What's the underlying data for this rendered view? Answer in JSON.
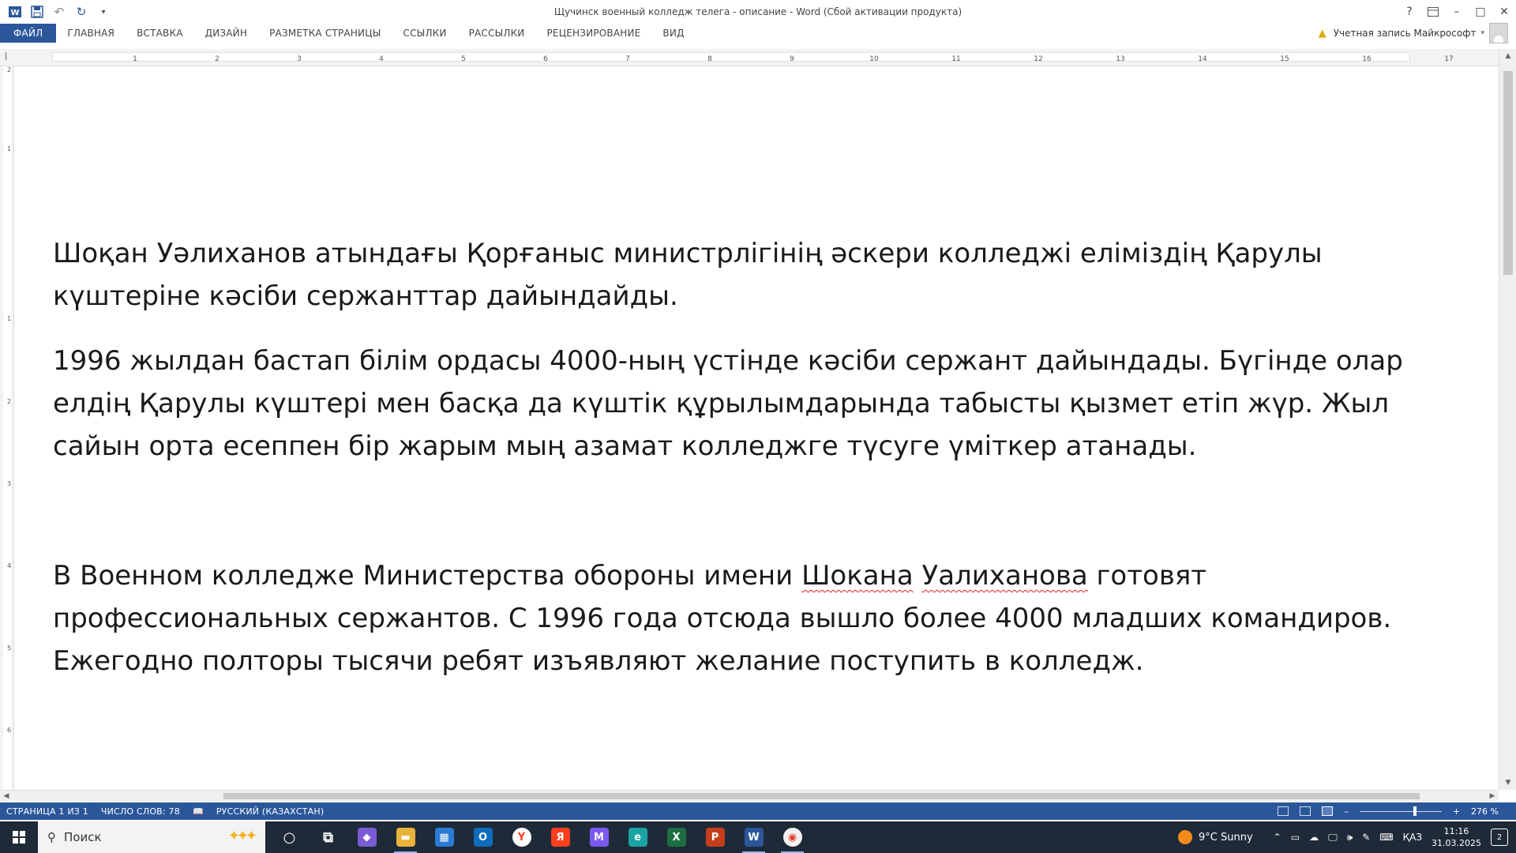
{
  "window": {
    "title": "Щучинск военный колледж  телега - описание - Word (Сбой активации продукта)",
    "help_icon": "?",
    "ribbon_display_icon": "ribbon-display-options-icon",
    "minimize_icon": "–",
    "restore_icon": "□",
    "close_icon": "✕"
  },
  "quick_access": {
    "app_icon": "word-app-icon",
    "save_icon": "save-icon",
    "undo_icon": "undo-icon",
    "redo_icon": "redo-icon",
    "customize_icon": "▾"
  },
  "ribbon": {
    "tabs": [
      {
        "label": "ФАЙЛ"
      },
      {
        "label": "ГЛАВНАЯ"
      },
      {
        "label": "ВСТАВКА"
      },
      {
        "label": "ДИЗАЙН"
      },
      {
        "label": "РАЗМЕТКА СТРАНИЦЫ"
      },
      {
        "label": "ССЫЛКИ"
      },
      {
        "label": "РАССЫЛКИ"
      },
      {
        "label": "РЕЦЕНЗИРОВАНИЕ"
      },
      {
        "label": "ВИД"
      }
    ],
    "account_label": "Учетная запись Майкрософт"
  },
  "ruler": {
    "numbers": [
      "1",
      "2",
      "3",
      "4",
      "5",
      "6",
      "7",
      "8",
      "9",
      "10",
      "11",
      "12",
      "13",
      "14",
      "15",
      "16",
      "17"
    ],
    "vertical_numbers": [
      "2",
      "1",
      "1",
      "2",
      "3",
      "4",
      "5",
      "6"
    ]
  },
  "document": {
    "paragraphs": [
      {
        "text": "Шоқан Уәлиханов атындағы Қорғаныс министрлігінің әскери колледжі еліміздің Қарулы күштеріне кәсіби сержанттар дайындайды."
      },
      {
        "text": "1996 жылдан бастап білім ордасы 4000-ның үстінде кәсіби сержант дайындады. Бүгінде олар елдің Қарулы күштері мен басқа да күштік құрылымдарында табысты қызмет етіп жүр. Жыл сайын орта есеппен бір жарым мың азамат колледжге түсуге үміткер атанады."
      },
      {
        "text_before": "В Военном колледже Министерства обороны имени ",
        "misspelled_1": "Шокана",
        "space": " ",
        "misspelled_2": "Уалиханова",
        "text_after": " готовят профессиональных сержантов. С 1996 года отсюда вышло более 4000 младших командиров. Ежегодно полторы тысячи ребят изъявляют желание поступить в колледж."
      }
    ]
  },
  "status": {
    "page": "СТРАНИЦА 1 ИЗ 1",
    "words": "ЧИСЛО СЛОВ: 78",
    "language": "РУССКИЙ (КАЗАХСТАН)",
    "zoom_minus": "–",
    "zoom_plus": "+",
    "zoom": "276 %"
  },
  "taskbar": {
    "search_placeholder": "Поиск",
    "apps": [
      {
        "name": "cortana-icon",
        "glyph": "○"
      },
      {
        "name": "task-view-icon",
        "glyph": "⧉"
      },
      {
        "name": "copilot-icon",
        "glyph": "◆"
      },
      {
        "name": "file-explorer-icon",
        "glyph": "▬"
      },
      {
        "name": "store-icon",
        "glyph": "▦"
      },
      {
        "name": "outlook-icon",
        "glyph": "O"
      },
      {
        "name": "yandex-browser-icon",
        "glyph": "Y"
      },
      {
        "name": "yandex-icon",
        "glyph": "Я"
      },
      {
        "name": "m365-icon",
        "glyph": "M"
      },
      {
        "name": "edge-icon",
        "glyph": "e"
      },
      {
        "name": "excel-icon",
        "glyph": "X"
      },
      {
        "name": "powerpoint-icon",
        "glyph": "P"
      },
      {
        "name": "word-icon",
        "glyph": "W"
      },
      {
        "name": "chrome-icon",
        "glyph": "◉"
      }
    ],
    "weather": "9°C  Sunny",
    "language": "ҚАЗ",
    "time": "11:16",
    "date": "31.03.2025",
    "notifications": "2"
  },
  "colors": {
    "accent": "#2b579a",
    "taskbar": "#1f2a38",
    "spellcheck": "#e02020"
  }
}
